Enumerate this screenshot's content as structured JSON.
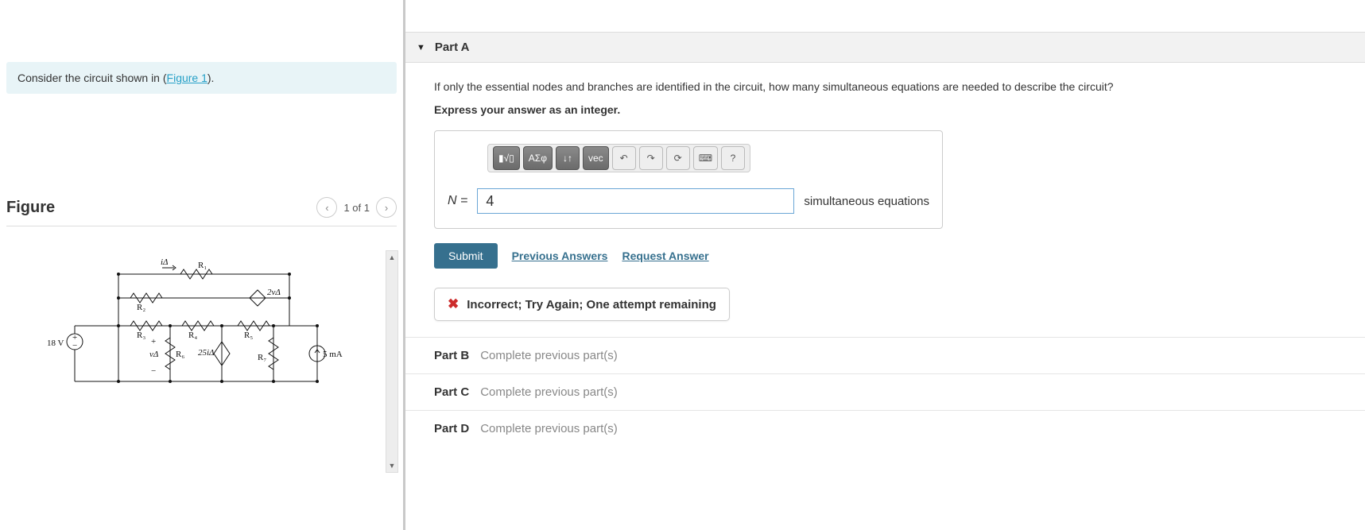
{
  "prompt": {
    "prefix": "Consider the circuit shown in (",
    "link": "Figure 1",
    "suffix": ")."
  },
  "figure": {
    "title": "Figure",
    "counter": "1 of 1",
    "labels": {
      "src_voltage": "18 V",
      "src_current": "5 mA",
      "i_delta": "iΔ",
      "R1": "R₁",
      "R2": "R₂",
      "R3": "R₃",
      "R4": "R₄",
      "R5": "R₅",
      "R6": "R₆",
      "R7": "R₇",
      "ccvs": "2vΔ",
      "cccs": "25iΔ",
      "v_delta": "vΔ"
    }
  },
  "partA": {
    "title": "Part A",
    "question": "If only the essential nodes and branches are identified in the circuit, how many simultaneous equations are needed to describe the circuit?",
    "instruction": "Express your answer as an integer.",
    "toolbar": {
      "templates": "▮√▯",
      "greek": "ΑΣφ",
      "subsuper": "↓↑",
      "vec": "vec",
      "undo": "↶",
      "redo": "↷",
      "reset": "⟳",
      "keyboard": "⌨",
      "help": "?"
    },
    "var": "N",
    "equals": " = ",
    "value": "4",
    "unit": "simultaneous equations",
    "submit": "Submit",
    "prev": "Previous Answers",
    "request": "Request Answer",
    "feedback_icon": "✖",
    "feedback": "Incorrect; Try Again; One attempt remaining"
  },
  "locked": [
    {
      "label": "Part B",
      "msg": "Complete previous part(s)"
    },
    {
      "label": "Part C",
      "msg": "Complete previous part(s)"
    },
    {
      "label": "Part D",
      "msg": "Complete previous part(s)"
    }
  ]
}
